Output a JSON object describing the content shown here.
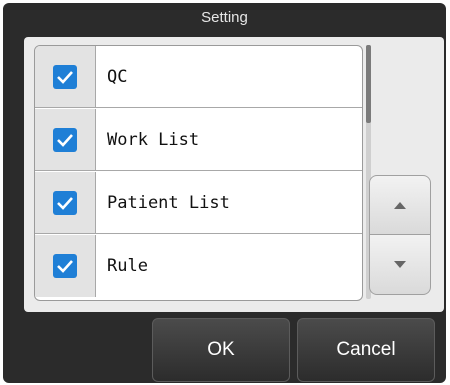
{
  "dialog": {
    "title": "Setting"
  },
  "items": [
    {
      "label": "QC",
      "checked": true
    },
    {
      "label": "Work List",
      "checked": true
    },
    {
      "label": "Patient List",
      "checked": true
    },
    {
      "label": "Rule",
      "checked": true
    }
  ],
  "scroll": {
    "up_icon": "triangle-up-icon",
    "down_icon": "triangle-down-icon"
  },
  "buttons": {
    "ok_label": "OK",
    "cancel_label": "Cancel"
  },
  "colors": {
    "accent": "#1f7fd6",
    "dialog_bg": "#2b2b2b",
    "panel_bg": "#ebebeb"
  }
}
